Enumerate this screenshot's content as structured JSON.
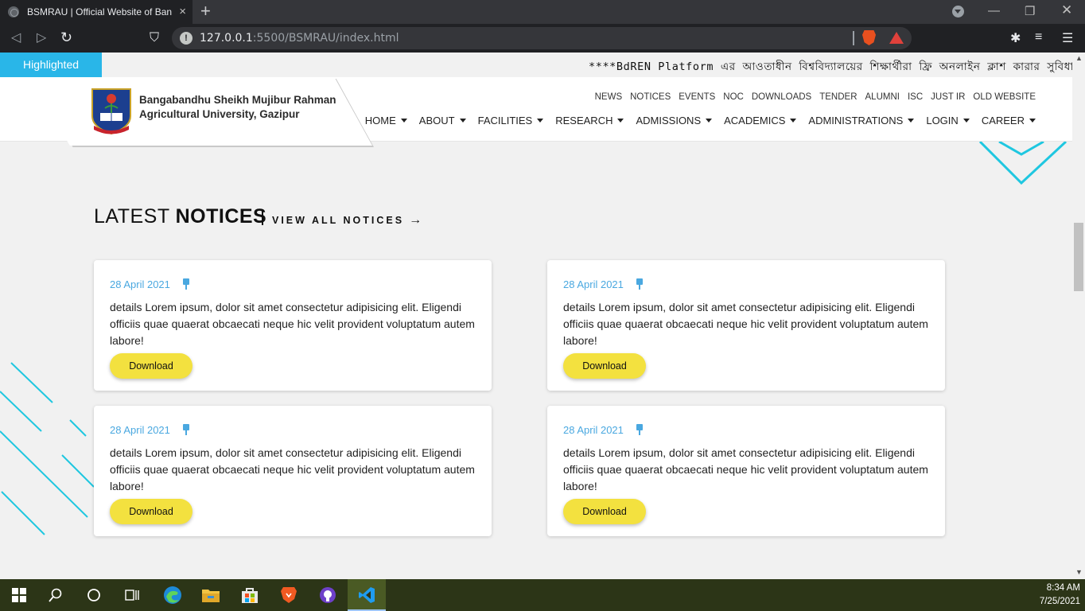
{
  "browser": {
    "tab_title": "BSMRAU | Official Website of Ban",
    "tab_close": "×",
    "new_tab": "+",
    "url_host": "127.0.0.1",
    "url_rest": ":5500/BSMRAU/index.html"
  },
  "highlight": {
    "label": "Highlighted",
    "marquee": "****BdREN Platform এর আওতাধীন বিশ্ববিদ্যালয়ের শিক্ষার্থীরা ফ্রি অনলাইন ক্লাশ কারার সুবিধা পাবে **"
  },
  "university": {
    "name_line1": "Bangabandhu Sheikh Mujibur Rahman",
    "name_line2": "Agricultural University, Gazipur"
  },
  "top_nav": [
    "NEWS",
    "NOTICES",
    "EVENTS",
    "NOC",
    "DOWNLOADS",
    "TENDER",
    "ALUMNI",
    "ISC",
    "JUST IR",
    "OLD WEBSITE"
  ],
  "main_nav": [
    "HOME",
    "ABOUT",
    "FACILITIES",
    "RESEARCH",
    "ADMISSIONS",
    "ACADEMICS",
    "ADMINISTRATIONS",
    "LOGIN",
    "CAREER"
  ],
  "section": {
    "title_light": "LATEST ",
    "title_bold": "NOTICES",
    "view_all": "VIEW ALL NOTICES",
    "arrow": "→"
  },
  "notices": [
    {
      "date": "28 April 2021",
      "text": "details Lorem ipsum, dolor sit amet consectetur adipisicing elit. Eligendi officiis quae quaerat obcaecati neque hic velit provident voluptatum autem labore!",
      "button": "Download"
    },
    {
      "date": "28 April 2021",
      "text": "details Lorem ipsum, dolor sit amet consectetur adipisicing elit. Eligendi officiis quae quaerat obcaecati neque hic velit provident voluptatum autem labore!",
      "button": "Download"
    },
    {
      "date": "28 April 2021",
      "text": "details Lorem ipsum, dolor sit amet consectetur adipisicing elit. Eligendi officiis quae quaerat obcaecati neque hic velit provident voluptatum autem labore!",
      "button": "Download"
    },
    {
      "date": "28 April 2021",
      "text": "details Lorem ipsum, dolor sit amet consectetur adipisicing elit. Eligendi officiis quae quaerat obcaecati neque hic velit provident voluptatum autem labore!",
      "button": "Download"
    }
  ],
  "taskbar": {
    "time": "8:34 AM",
    "date": "7/25/2021",
    "icons": [
      "windows-start-icon",
      "search-icon",
      "cortana-icon",
      "task-view-icon",
      "edge-icon",
      "file-explorer-icon",
      "store-icon",
      "brave-icon",
      "github-desktop-icon",
      "vscode-icon"
    ]
  },
  "colors": {
    "accent_blue": "#29b6e8",
    "date_blue": "#4aa8e0",
    "button_yellow": "#f3e13f",
    "taskbar": "#2c3517"
  }
}
